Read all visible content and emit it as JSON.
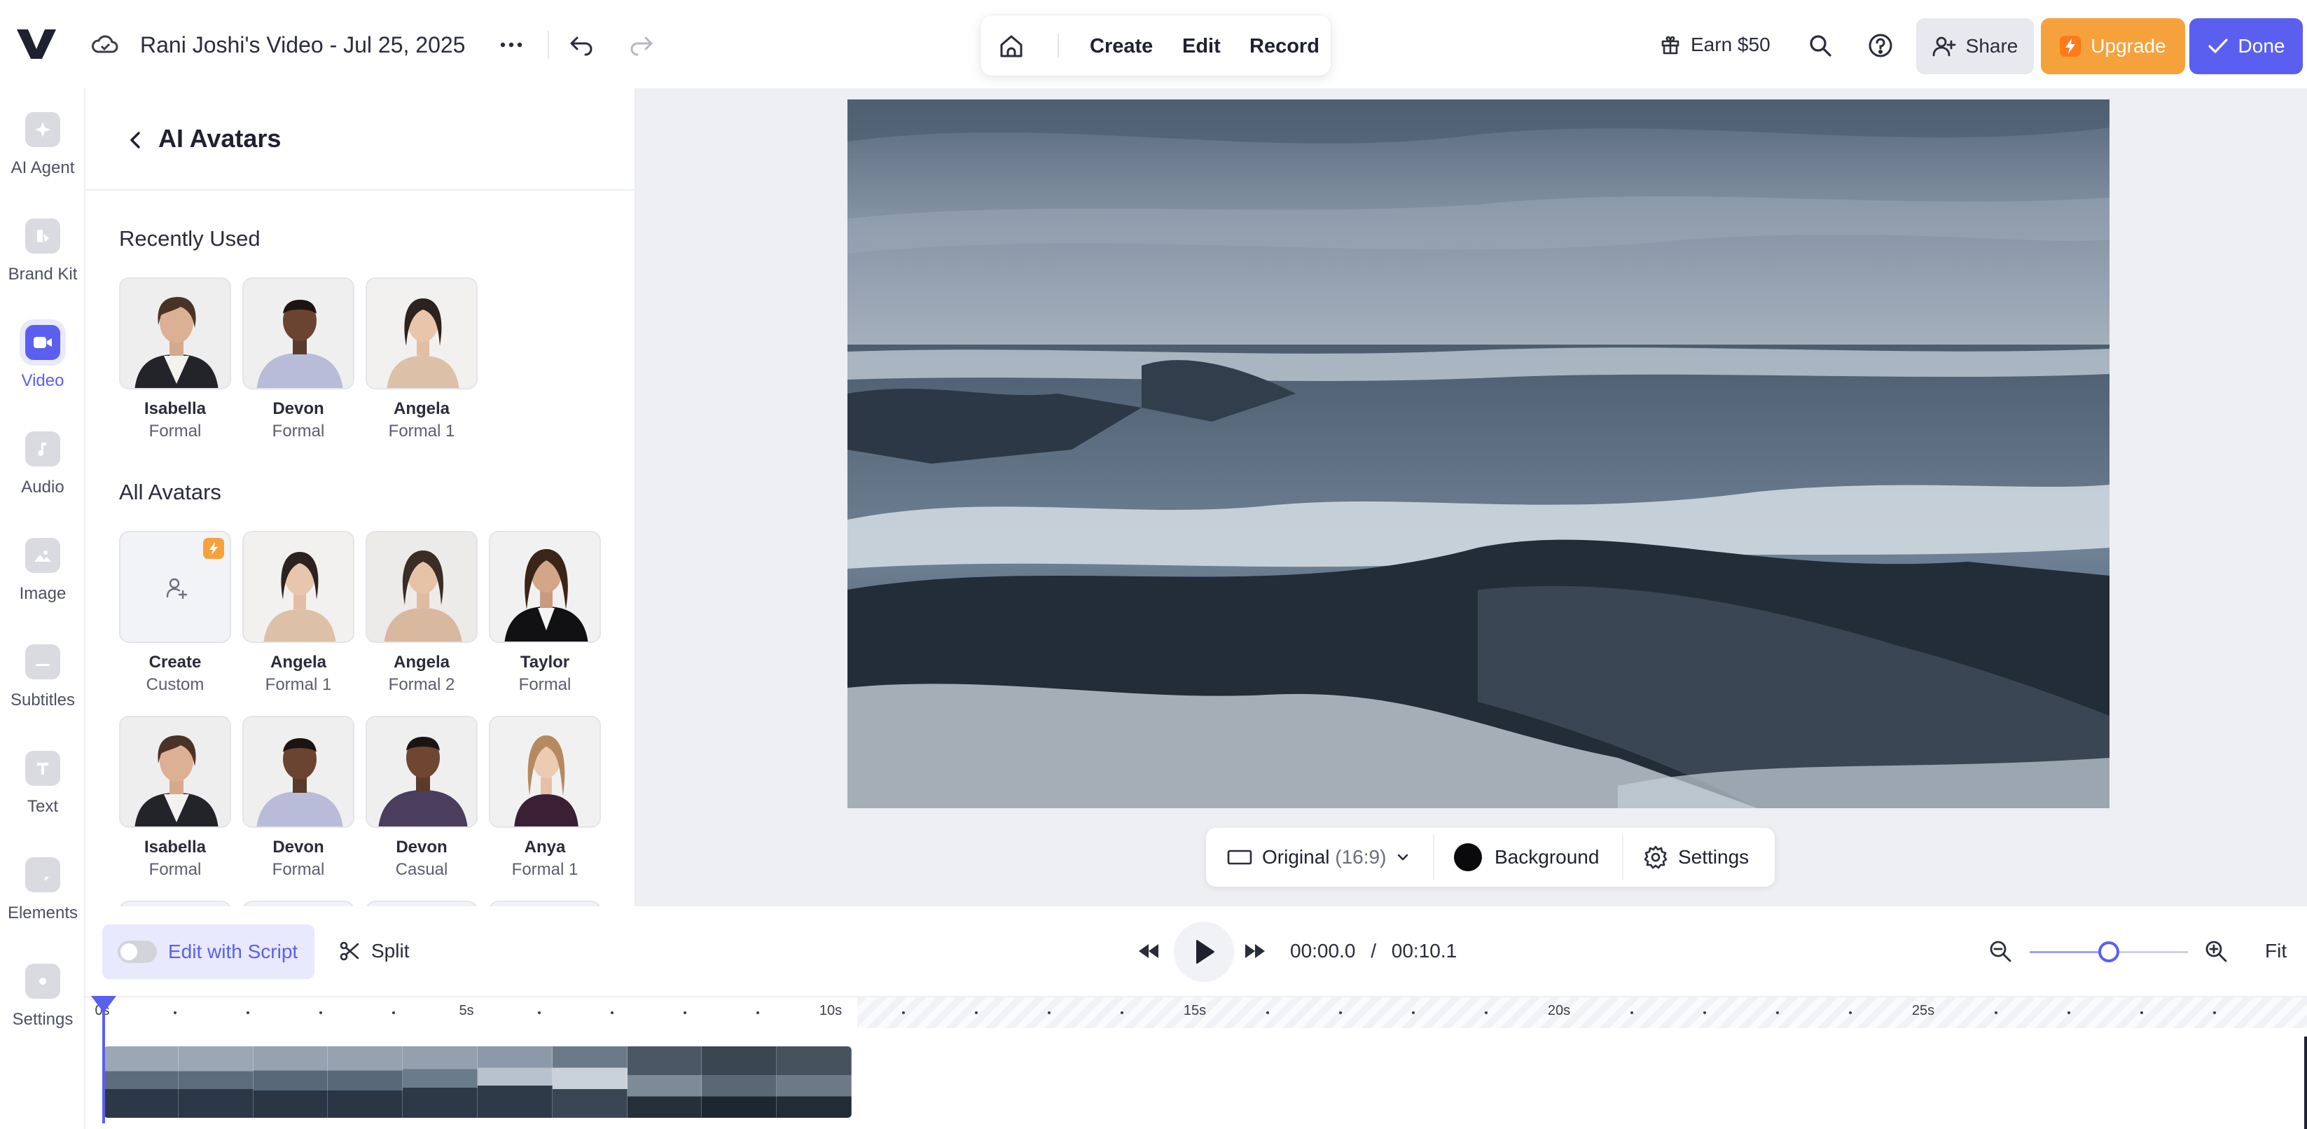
{
  "header": {
    "title": "Rani Joshi's Video - Jul 25, 2025",
    "nav": {
      "create": "Create",
      "edit": "Edit",
      "record": "Record"
    },
    "earn_label": "Earn $50",
    "share_label": "Share",
    "upgrade_label": "Upgrade",
    "done_label": "Done"
  },
  "sidebar": {
    "items": [
      {
        "label": "AI Agent",
        "icon": "sparkle-icon"
      },
      {
        "label": "Brand Kit",
        "icon": "brand-kit-icon"
      },
      {
        "label": "Video",
        "icon": "video-camera-icon",
        "active": true
      },
      {
        "label": "Audio",
        "icon": "music-note-icon"
      },
      {
        "label": "Image",
        "icon": "image-icon"
      },
      {
        "label": "Subtitles",
        "icon": "subtitles-icon"
      },
      {
        "label": "Text",
        "icon": "text-icon"
      },
      {
        "label": "Elements",
        "icon": "elements-icon"
      },
      {
        "label": "Settings",
        "icon": "settings-icon"
      }
    ]
  },
  "panel": {
    "title": "AI Avatars",
    "recently_used_heading": "Recently Used",
    "all_avatars_heading": "All Avatars",
    "recent": [
      {
        "name": "Isabella",
        "style": "Formal"
      },
      {
        "name": "Devon",
        "style": "Formal"
      },
      {
        "name": "Angela",
        "style": "Formal 1"
      }
    ],
    "all_row1": [
      {
        "name": "Create",
        "style": "Custom"
      },
      {
        "name": "Angela",
        "style": "Formal 1"
      },
      {
        "name": "Angela",
        "style": "Formal 2"
      },
      {
        "name": "Taylor",
        "style": "Formal"
      }
    ],
    "all_row2": [
      {
        "name": "Isabella",
        "style": "Formal"
      },
      {
        "name": "Devon",
        "style": "Formal"
      },
      {
        "name": "Devon",
        "style": "Casual"
      },
      {
        "name": "Anya",
        "style": "Formal 1"
      }
    ]
  },
  "canvas": {
    "aspect_label": "Original",
    "aspect_ratio": "(16:9)",
    "background_label": "Background",
    "settings_label": "Settings"
  },
  "player": {
    "edit_with_script_label": "Edit with Script",
    "split_label": "Split",
    "current_time": "00:00.0",
    "separator": "/",
    "total_time": "00:10.1",
    "fit_label": "Fit",
    "zoom_level": 0.5
  },
  "timeline": {
    "tick_labels": [
      "0s",
      "5s",
      "10s",
      "15s",
      "20s",
      "25s"
    ]
  },
  "colors": {
    "accent": "#5b5ff0",
    "upgrade": "#f6a23c",
    "share_bg": "#e8e9ee"
  }
}
